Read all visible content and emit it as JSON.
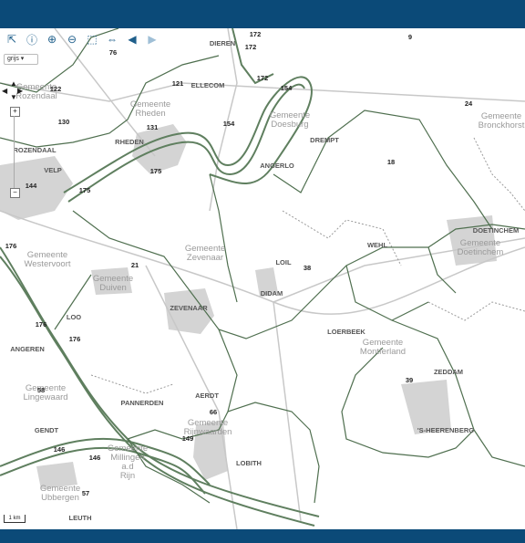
{
  "toolbar": {
    "tools": [
      {
        "name": "select-arrow-icon",
        "glyph": "⇱"
      },
      {
        "name": "info-icon",
        "glyph": "ⓘ"
      },
      {
        "name": "zoom-in-icon",
        "glyph": "⊕"
      },
      {
        "name": "zoom-out-icon",
        "glyph": "⊖"
      },
      {
        "name": "zoom-box-icon",
        "glyph": "⬚"
      },
      {
        "name": "measure-icon",
        "glyph": "⇔"
      },
      {
        "name": "back-arrow-icon",
        "glyph": "◀"
      },
      {
        "name": "forward-arrow-icon",
        "glyph": "▶"
      }
    ]
  },
  "layer_select": {
    "value": "grijs ▾"
  },
  "scale": {
    "label": "1 km"
  },
  "gemeente_labels": [
    {
      "text": "Gemeente\nZevenaar"
    },
    {
      "text": "Gemeente\nDuiven"
    },
    {
      "text": "Gemeente\nWestervoort"
    },
    {
      "text": "Gemeente\nRozendaal"
    },
    {
      "text": "Gemeente\nRheden"
    },
    {
      "text": "Gemeente\nDoesburg"
    },
    {
      "text": "Gemeente\nBronckhorst"
    },
    {
      "text": "Gemeente\nDoetinchem"
    },
    {
      "text": "Gemeente\nMontferland"
    },
    {
      "text": "Gemeente\nLingewaard"
    },
    {
      "text": "Gemeente\nRijnwaarden"
    },
    {
      "text": "Gemeente\nMillingen\na.d\nRijn"
    },
    {
      "text": "Gemeente\nUbbergen"
    }
  ],
  "town_labels": [
    "DIEREN",
    "ELLECOM",
    "RHEDEN",
    "DREMPT",
    "ANGERLO",
    "ROZENDAAL",
    "VELP",
    "DOETINCHEM",
    "WEHL",
    "LOIL",
    "DIDAM",
    "ZEVENAAR",
    "LOO",
    "ANGEREN",
    "LOERBEEK",
    "ZEDDAM",
    "PANNERDEN",
    "AERDT",
    "'S-HEERENBERG",
    "GENDT",
    "LOBITH",
    "LEUTH"
  ],
  "route_numbers": [
    "172",
    "172",
    "172",
    "9",
    "76",
    "121",
    "122",
    "154",
    "154",
    "24",
    "131",
    "130",
    "175",
    "18",
    "144",
    "175",
    "176",
    "21",
    "38",
    "176",
    "176",
    "58",
    "66",
    "39",
    "149",
    "146",
    "146",
    "57"
  ]
}
